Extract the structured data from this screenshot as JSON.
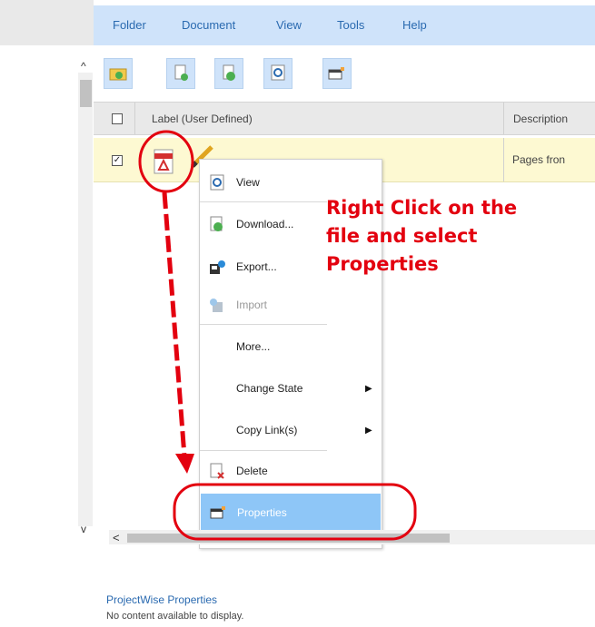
{
  "menu": [
    "Folder",
    "Document",
    "View",
    "Tools",
    "Help"
  ],
  "toolbar_icons": [
    "folder-up-icon",
    "new-document-icon",
    "download-icon",
    "view-document-icon",
    "properties-icon"
  ],
  "grid": {
    "header_label": "Label (User Defined)",
    "header_description": "Description",
    "row_description": "Pages fron"
  },
  "context_menu": {
    "view": "View",
    "download": "Download...",
    "export": "Export...",
    "import": "Import",
    "more": "More...",
    "change_state": "Change State",
    "copy_links": "Copy Link(s)",
    "delete": "Delete",
    "properties": "Properties"
  },
  "annotation": {
    "line1": "Right Click on the",
    "line2": "file and select",
    "line3": "Properties"
  },
  "properties_panel": {
    "title": "ProjectWise Properties",
    "empty": "No content available to display."
  },
  "colors": {
    "annotation": "#e3000f",
    "menubar": "#cfe3fa",
    "selected_row": "#fdf9d2",
    "highlight": "#8ec6f7"
  }
}
